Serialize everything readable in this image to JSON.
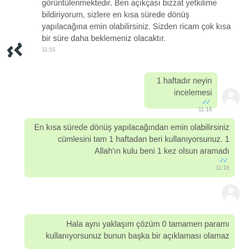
{
  "messages": [
    {
      "lines": [
        "görüntülenmektedir. Ben açıkçası bizzat yetkilime",
        "bildiriyorum, sizlere en kısa sürede dönüş",
        "yapılacağına emin olabilirsiniz. Sizden ricam çok kısa",
        "bir süre daha beklemeniz olacaktır."
      ],
      "time": "11:15",
      "direction": "incoming"
    },
    {
      "lines": [
        "1 haftadır neyin incelemesi"
      ],
      "time": "11:16",
      "direction": "outgoing",
      "ticks": "✓✓"
    },
    {
      "lines": [
        "En kısa sürede dönüş yapılacağından emin olabilirsiniz",
        "cümlesini tam 1 haftadan beri kullanıyorsunuz. 1",
        "Allah'ın kulu beni 1 kez olsun aramadı"
      ],
      "time": "11:16",
      "direction": "outgoing",
      "ticks": "✓✓"
    },
    {
      "lines": [
        "Hala aynı yaklaşım çözüm 0 tamamen paramı",
        "kullanıyorsunuz bunun başka bir açıklaması olamaz"
      ],
      "direction": "outgoing"
    }
  ],
  "colors": {
    "outgoing_bubble": "#dcf8c6",
    "ticks": "#4fb6ec",
    "logo": "#2d3a3e"
  },
  "icons": [
    "brand-logo-icon",
    "avatar-icon",
    "double-check-icon"
  ]
}
